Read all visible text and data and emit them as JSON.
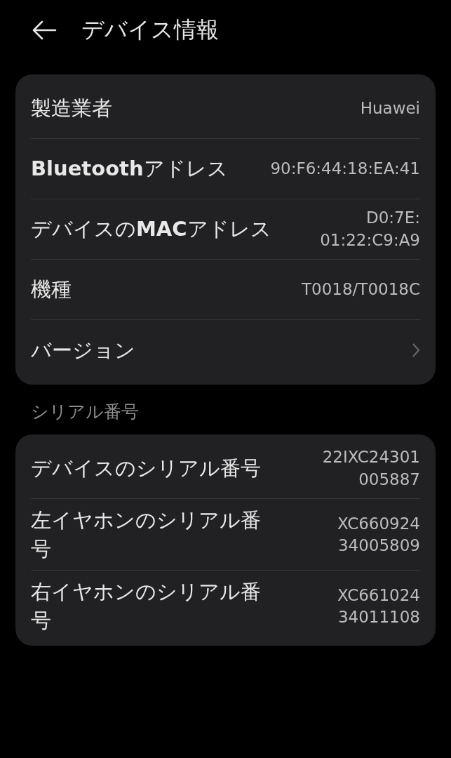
{
  "header": {
    "title": "デバイス情報"
  },
  "sections": [
    {
      "rows": [
        {
          "kind": "value",
          "label": "製造業者",
          "value": "Huawei"
        },
        {
          "kind": "value",
          "label": "**Bluetooth**アドレス",
          "value": "90:F6:44:18:EA:41"
        },
        {
          "kind": "value",
          "label": "デバイスの**MAC**アドレス",
          "value": "D0:7E:\n01:22:C9:A9"
        },
        {
          "kind": "value",
          "label": "機種",
          "value": "T0018/T0018C"
        },
        {
          "kind": "link",
          "label": "バージョン"
        }
      ]
    },
    {
      "title": "シリアル番号",
      "rows": [
        {
          "kind": "value",
          "label": "デバイスのシリアル番号",
          "value": "22IXC24301\n005887"
        },
        {
          "kind": "value",
          "label": "左イヤホンのシリアル番号",
          "value": "XC660924\n34005809"
        },
        {
          "kind": "value",
          "label": "右イヤホンのシリアル番号",
          "value": "XC661024\n34011108"
        }
      ]
    }
  ]
}
